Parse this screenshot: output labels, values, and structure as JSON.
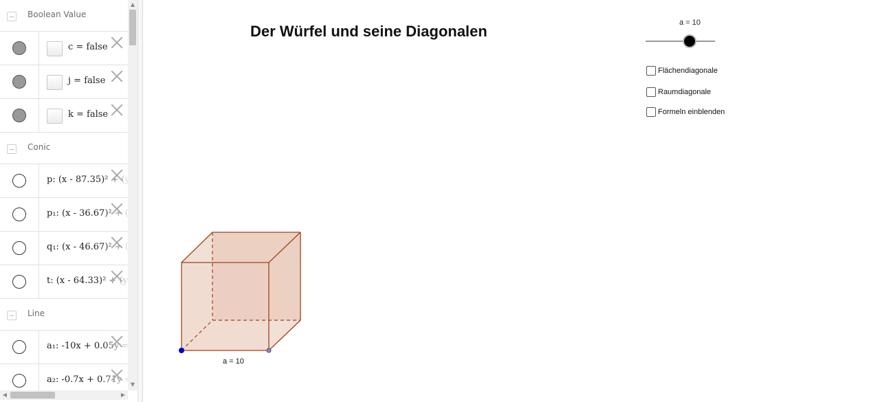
{
  "algebra": {
    "groups": [
      {
        "title": "Boolean Value",
        "items": [
          {
            "expr": "c = false"
          },
          {
            "expr": "j = false"
          },
          {
            "expr": "k = false"
          }
        ]
      },
      {
        "title": "Conic",
        "items": [
          {
            "expr": "p: (x - 87.35)² + (y"
          },
          {
            "expr": "p₁: (x - 36.67)² + (y"
          },
          {
            "expr": "q₁: (x - 46.67)² + (y"
          },
          {
            "expr": "t: (x - 64.33)² + (y"
          }
        ]
      },
      {
        "title": "Line",
        "items": [
          {
            "expr": "a₁: -10x + 0.05y = -"
          },
          {
            "expr": "a₂: -0.7x + 0.71y = -"
          }
        ]
      }
    ]
  },
  "graphics": {
    "title": "Der Würfel und seine Diagonalen",
    "slider": {
      "label": "a = 10",
      "value": 10
    },
    "checkboxes": [
      {
        "label": "Flächendiagonale",
        "checked": false
      },
      {
        "label": "Raumdiagonale",
        "checked": false
      },
      {
        "label": "Formeln einblenden",
        "checked": false
      }
    ],
    "cube_label": "a = 10",
    "colors": {
      "cube_edge": "#a0421b",
      "cube_fill": "#e8c4b4",
      "point_blue": "#0000cc",
      "point_light": "#8a8ae0"
    }
  }
}
